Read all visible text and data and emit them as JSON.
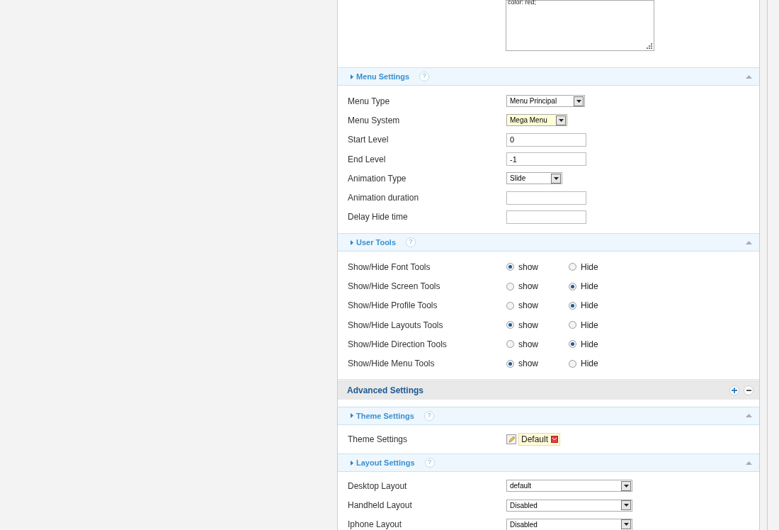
{
  "textarea": {
    "value": "color: red;"
  },
  "blocks": [
    {
      "kind": "section",
      "title": "Menu Settings",
      "help": "?",
      "collapsed": false,
      "rows": [
        {
          "kind": "select",
          "label": "Menu Type",
          "value": "Menu Principal",
          "focused": false
        },
        {
          "kind": "select",
          "label": "Menu System",
          "value": "Mega Menu",
          "focused": true
        },
        {
          "kind": "text",
          "label": "Start Level",
          "value": "0"
        },
        {
          "kind": "text",
          "label": "End Level",
          "value": "-1"
        },
        {
          "kind": "select",
          "label": "Animation Type",
          "value": "Slide",
          "focused": false
        },
        {
          "kind": "text",
          "label": "Animation duration",
          "value": ""
        },
        {
          "kind": "text",
          "label": "Delay Hide time",
          "value": ""
        }
      ]
    },
    {
      "kind": "section",
      "title": "User Tools",
      "help": "?",
      "collapsed": false,
      "rows": [
        {
          "kind": "radio",
          "label": "Show/Hide Font Tools",
          "options": [
            {
              "label": "show",
              "selected": true
            },
            {
              "label": "Hide",
              "selected": false
            }
          ]
        },
        {
          "kind": "radio",
          "label": "Show/Hide Screen Tools",
          "options": [
            {
              "label": "show",
              "selected": false
            },
            {
              "label": "Hide",
              "selected": true
            }
          ]
        },
        {
          "kind": "radio",
          "label": "Show/Hide Profile Tools",
          "options": [
            {
              "label": "show",
              "selected": false
            },
            {
              "label": "Hide",
              "selected": true
            }
          ]
        },
        {
          "kind": "radio",
          "label": "Show/Hide Layouts Tools",
          "options": [
            {
              "label": "show",
              "selected": true
            },
            {
              "label": "Hide",
              "selected": false
            }
          ]
        },
        {
          "kind": "radio",
          "label": "Show/Hide Direction Tools",
          "options": [
            {
              "label": "show",
              "selected": false
            },
            {
              "label": "Hide",
              "selected": true
            }
          ]
        },
        {
          "kind": "radio",
          "label": "Show/Hide Menu Tools",
          "options": [
            {
              "label": "show",
              "selected": true
            },
            {
              "label": "Hide",
              "selected": false
            }
          ]
        }
      ]
    },
    {
      "kind": "group",
      "title": "Advanced Settings"
    },
    {
      "kind": "section",
      "title": "Theme Settings",
      "help": "?",
      "collapsed": false,
      "rows": [
        {
          "kind": "theme",
          "label": "Theme Settings",
          "value": "Default"
        }
      ]
    },
    {
      "kind": "section",
      "title": "Layout Settings",
      "help": "?",
      "collapsed": false,
      "rows": [
        {
          "kind": "select",
          "label": "Desktop Layout",
          "value": "default",
          "focused": false
        },
        {
          "kind": "select",
          "label": "Handheld Layout",
          "value": "Disabled",
          "focused": false
        },
        {
          "kind": "select",
          "label": "Iphone Layout",
          "value": "Disabled",
          "focused": false
        }
      ]
    }
  ]
}
